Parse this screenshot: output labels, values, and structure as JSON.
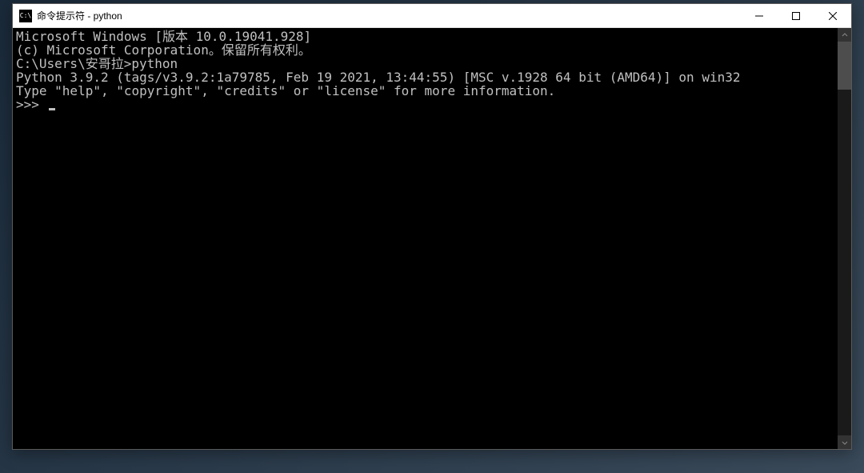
{
  "window": {
    "title": "命令提示符 - python",
    "icon_text": "C:\\"
  },
  "terminal": {
    "lines": [
      "Microsoft Windows [版本 10.0.19041.928]",
      "(c) Microsoft Corporation。保留所有权利。",
      "",
      "C:\\Users\\安哥拉>python",
      "Python 3.9.2 (tags/v3.9.2:1a79785, Feb 19 2021, 13:44:55) [MSC v.1928 64 bit (AMD64)] on win32",
      "Type \"help\", \"copyright\", \"credits\" or \"license\" for more information."
    ],
    "prompt": ">>> "
  }
}
